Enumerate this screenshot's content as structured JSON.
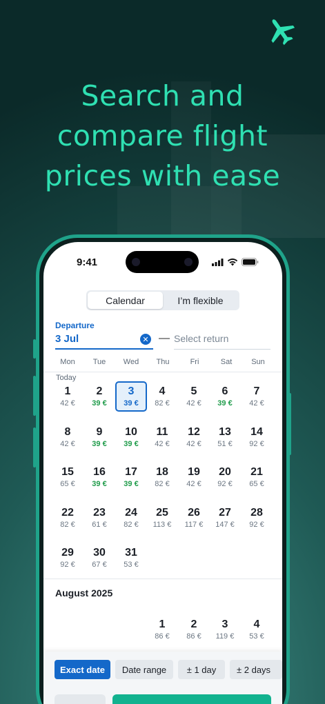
{
  "headline": "Search and compare flight prices with ease",
  "status": {
    "time": "9:41"
  },
  "tabs": [
    {
      "label": "Calendar",
      "active": true
    },
    {
      "label": "I’m flexible",
      "active": false
    }
  ],
  "departure": {
    "label": "Departure",
    "value": "3 Jul"
  },
  "return_placeholder": "Select return",
  "weekdays": [
    "Mon",
    "Tue",
    "Wed",
    "Thu",
    "Fri",
    "Sat",
    "Sun"
  ],
  "today_label": "Today",
  "july": [
    {
      "day": "1",
      "price": "42 €",
      "cheap": false
    },
    {
      "day": "2",
      "price": "39 €",
      "cheap": true
    },
    {
      "day": "3",
      "price": "39 €",
      "cheap": true,
      "selected": true
    },
    {
      "day": "4",
      "price": "82 €",
      "cheap": false
    },
    {
      "day": "5",
      "price": "42 €",
      "cheap": false
    },
    {
      "day": "6",
      "price": "39 €",
      "cheap": true
    },
    {
      "day": "7",
      "price": "42 €",
      "cheap": false
    },
    {
      "day": "8",
      "price": "42 €",
      "cheap": false
    },
    {
      "day": "9",
      "price": "39 €",
      "cheap": true
    },
    {
      "day": "10",
      "price": "39 €",
      "cheap": true
    },
    {
      "day": "11",
      "price": "42 €",
      "cheap": false
    },
    {
      "day": "12",
      "price": "42 €",
      "cheap": false
    },
    {
      "day": "13",
      "price": "51 €",
      "cheap": false
    },
    {
      "day": "14",
      "price": "92 €",
      "cheap": false
    },
    {
      "day": "15",
      "price": "65 €",
      "cheap": false
    },
    {
      "day": "16",
      "price": "39 €",
      "cheap": true
    },
    {
      "day": "17",
      "price": "39 €",
      "cheap": true
    },
    {
      "day": "18",
      "price": "82 €",
      "cheap": false
    },
    {
      "day": "19",
      "price": "42 €",
      "cheap": false
    },
    {
      "day": "20",
      "price": "92 €",
      "cheap": false
    },
    {
      "day": "21",
      "price": "65 €",
      "cheap": false
    },
    {
      "day": "22",
      "price": "82 €",
      "cheap": false
    },
    {
      "day": "23",
      "price": "61 €",
      "cheap": false
    },
    {
      "day": "24",
      "price": "82 €",
      "cheap": false
    },
    {
      "day": "25",
      "price": "113 €",
      "cheap": false
    },
    {
      "day": "26",
      "price": "117 €",
      "cheap": false
    },
    {
      "day": "27",
      "price": "147 €",
      "cheap": false
    },
    {
      "day": "28",
      "price": "92 €",
      "cheap": false
    },
    {
      "day": "29",
      "price": "92 €",
      "cheap": false
    },
    {
      "day": "30",
      "price": "67 €",
      "cheap": false
    },
    {
      "day": "31",
      "price": "53 €",
      "cheap": false
    }
  ],
  "august_title": "August 2025",
  "august": [
    {
      "day": "1",
      "price": "86 €",
      "cheap": false
    },
    {
      "day": "2",
      "price": "86 €",
      "cheap": false
    },
    {
      "day": "3",
      "price": "119 €",
      "cheap": false
    },
    {
      "day": "4",
      "price": "53 €",
      "cheap": false
    }
  ],
  "chips": [
    {
      "label": "Exact date",
      "active": true
    },
    {
      "label": "Date range",
      "active": false
    },
    {
      "label": "±   1 day",
      "active": false
    },
    {
      "label": "±   2 days",
      "active": false
    }
  ],
  "colors": {
    "accent": "#1468c9",
    "brand_green": "#2fe0b2",
    "cheap_price": "#1f9b4a",
    "frame": "#1fa38a"
  }
}
